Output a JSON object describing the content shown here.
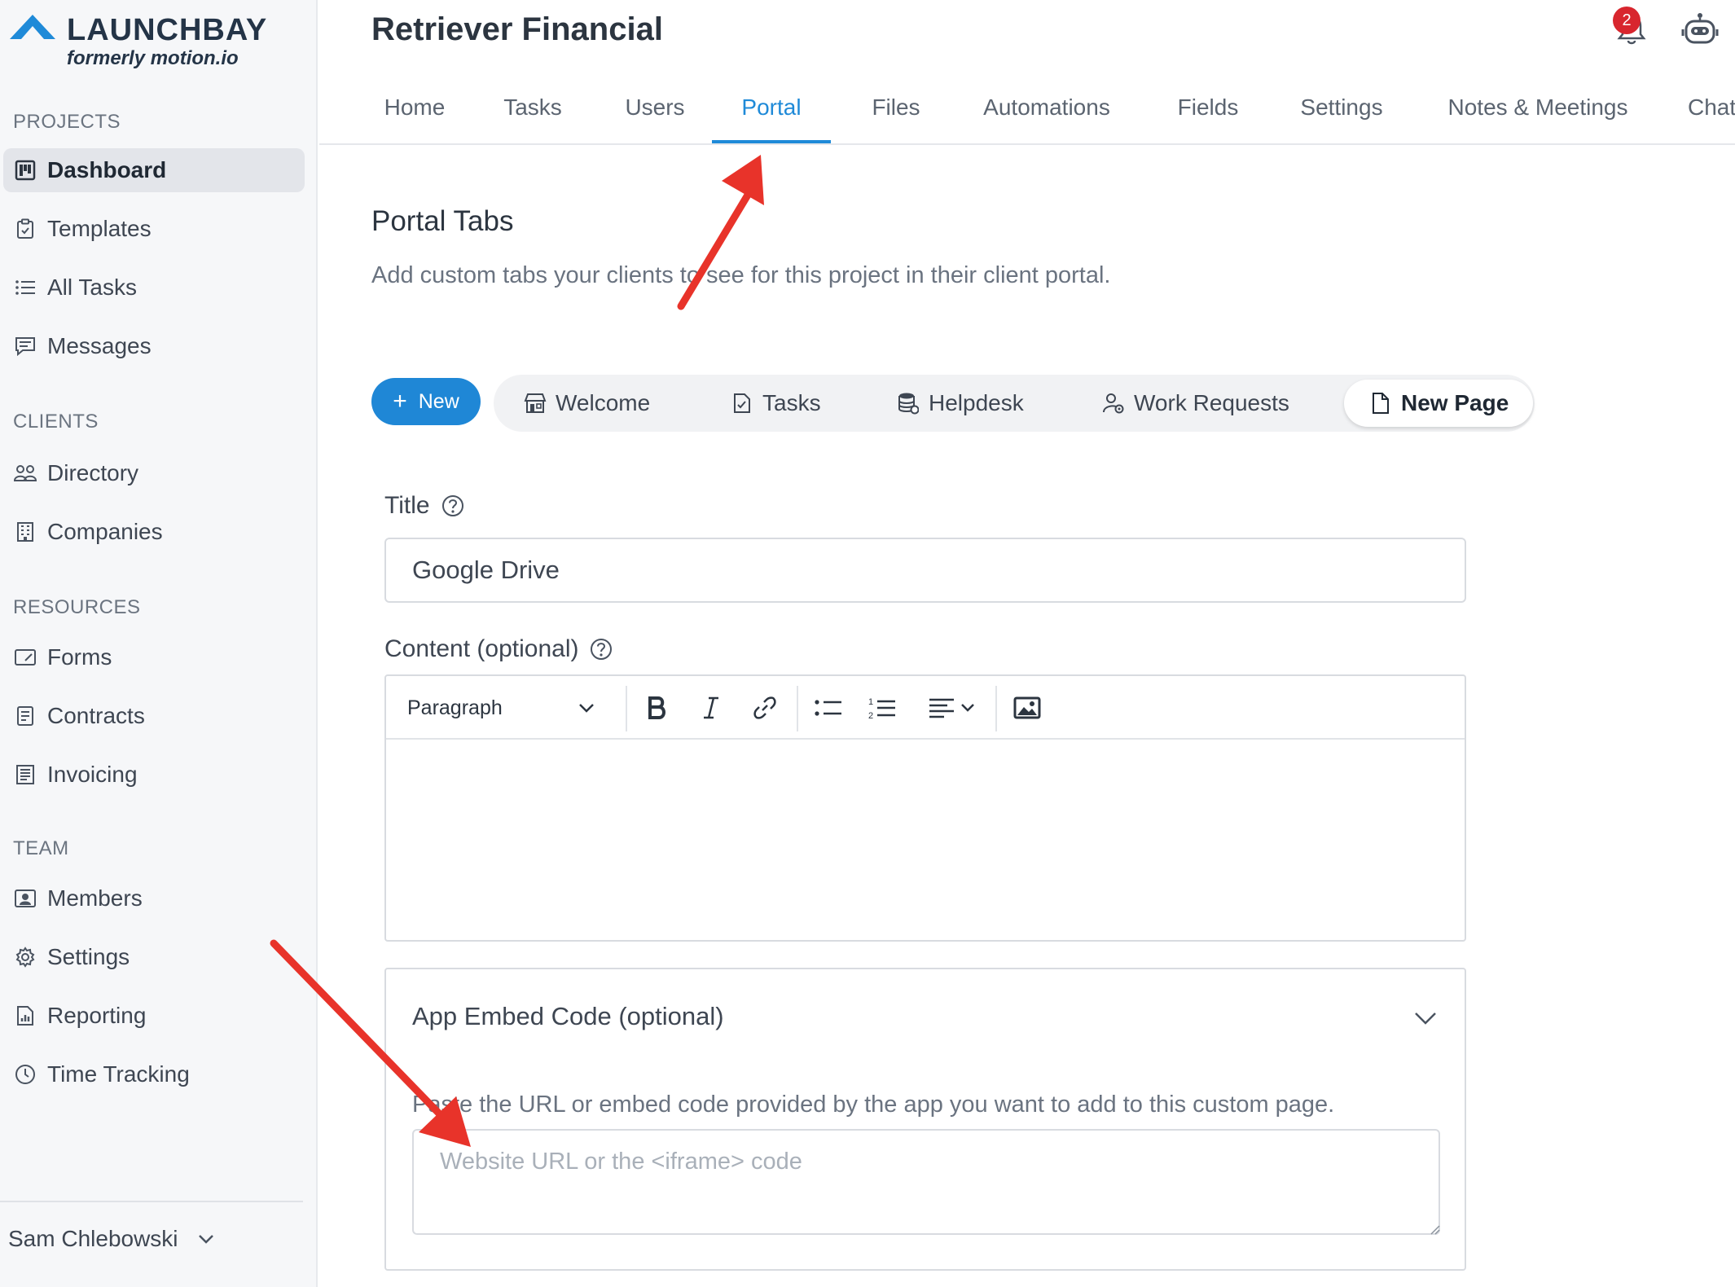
{
  "brand": {
    "name": "LAUNCHBAY",
    "subtitle": "formerly motion.io",
    "colors": {
      "accent": "#1f87d6",
      "logo": "#1f8ad8",
      "annotation_arrow": "#e8332a",
      "badge": "#d8262e"
    }
  },
  "sidebar": {
    "sections": [
      {
        "header": "PROJECTS",
        "items": [
          {
            "label": "Dashboard",
            "icon": "dashboard-icon",
            "active": true
          },
          {
            "label": "Templates",
            "icon": "clipboard-icon"
          },
          {
            "label": "All Tasks",
            "icon": "list-icon"
          },
          {
            "label": "Messages",
            "icon": "message-icon"
          }
        ]
      },
      {
        "header": "CLIENTS",
        "items": [
          {
            "label": "Directory",
            "icon": "people-icon"
          },
          {
            "label": "Companies",
            "icon": "building-icon"
          }
        ]
      },
      {
        "header": "RESOURCES",
        "items": [
          {
            "label": "Forms",
            "icon": "form-icon"
          },
          {
            "label": "Contracts",
            "icon": "document-icon"
          },
          {
            "label": "Invoicing",
            "icon": "invoice-icon"
          }
        ]
      },
      {
        "header": "TEAM",
        "items": [
          {
            "label": "Members",
            "icon": "member-icon"
          },
          {
            "label": "Settings",
            "icon": "gear-icon"
          },
          {
            "label": "Reporting",
            "icon": "report-icon"
          },
          {
            "label": "Time Tracking",
            "icon": "clock-icon"
          }
        ]
      }
    ],
    "user": {
      "name": "Sam Chlebowski"
    }
  },
  "header": {
    "project_title": "Retriever Financial",
    "notification_count": "2",
    "tabs": [
      {
        "label": "Home"
      },
      {
        "label": "Tasks"
      },
      {
        "label": "Users"
      },
      {
        "label": "Portal",
        "active": true
      },
      {
        "label": "Files"
      },
      {
        "label": "Automations"
      },
      {
        "label": "Fields"
      },
      {
        "label": "Settings"
      },
      {
        "label": "Notes & Meetings"
      },
      {
        "label": "Chat"
      }
    ]
  },
  "main": {
    "section_title": "Portal Tabs",
    "section_desc": "Add custom tabs your clients to see for this project in their client portal.",
    "new_button": "New",
    "portal_tabs": [
      {
        "label": "Welcome",
        "icon": "storefront-icon"
      },
      {
        "label": "Tasks",
        "icon": "task-doc-icon"
      },
      {
        "label": "Helpdesk",
        "icon": "database-icon"
      },
      {
        "label": "Work Requests",
        "icon": "person-gear-icon"
      },
      {
        "label": "New Page",
        "icon": "page-icon",
        "active": true
      }
    ],
    "title_field": {
      "label": "Title",
      "value": "Google Drive"
    },
    "content_field": {
      "label": "Content (optional)",
      "block_format": "Paragraph"
    },
    "embed": {
      "title": "App Embed Code (optional)",
      "help": "Paste the URL or embed code provided by the app you want to add to this custom page.",
      "placeholder": "Website URL or the <iframe> code"
    }
  }
}
